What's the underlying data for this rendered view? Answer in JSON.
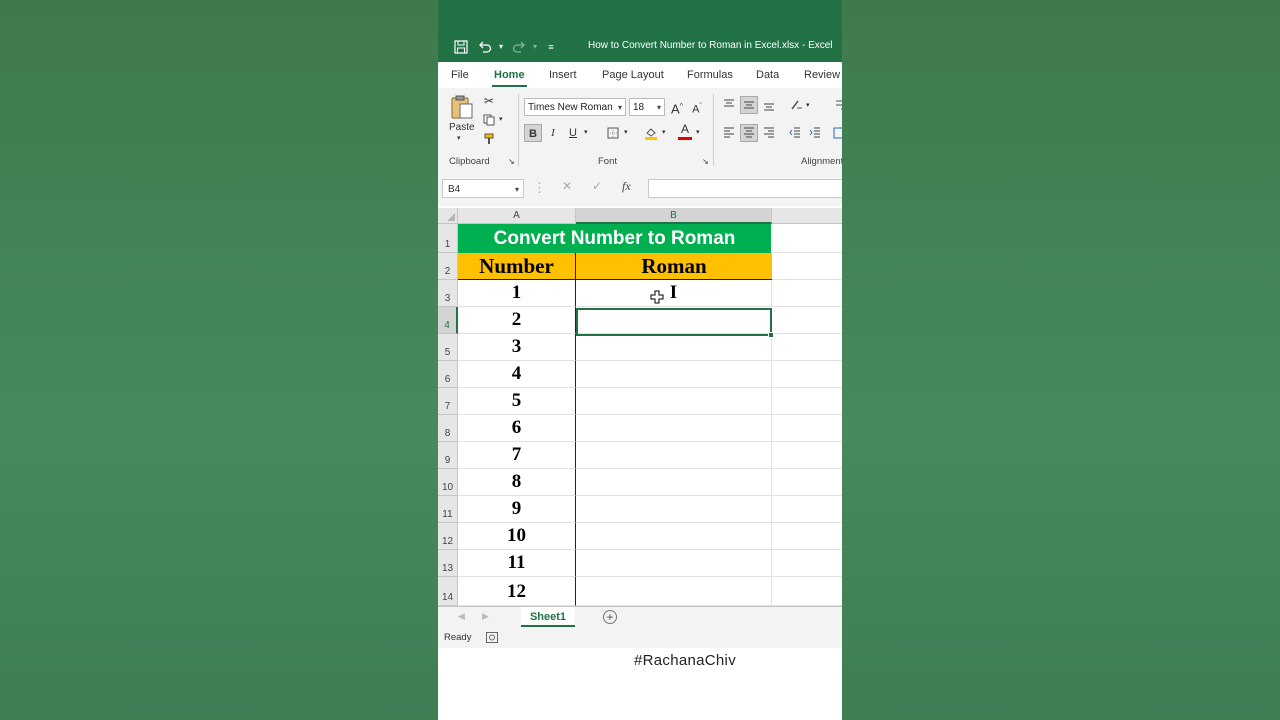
{
  "window": {
    "title": "How to Convert Number to Roman in Excel.xlsx  -  Excel"
  },
  "ribbon": {
    "tabs": [
      "File",
      "Home",
      "Insert",
      "Page Layout",
      "Formulas",
      "Data",
      "Review"
    ],
    "active_tab": "Home",
    "clipboard": {
      "paste_label": "Paste",
      "group_label": "Clipboard"
    },
    "font": {
      "font_name": "Times New Roman",
      "font_size": "18",
      "grow_label": "A",
      "shrink_label": "A",
      "bold_label": "B",
      "italic_label": "I",
      "underline_label": "U",
      "color_label": "A",
      "group_label": "Font"
    },
    "alignment": {
      "group_label": "Alignment"
    }
  },
  "formula_bar": {
    "name_box": "B4",
    "cancel_symbol": "✕",
    "enter_symbol": "✓",
    "fx_label": "fx",
    "content": ""
  },
  "sheet": {
    "columns": [
      "A",
      "B"
    ],
    "selected_column": "B",
    "selected_row": "4",
    "title": "Convert Number to Roman",
    "headers": {
      "number": "Number",
      "roman": "Roman"
    },
    "row_numbers": [
      "1",
      "2",
      "3",
      "4",
      "5",
      "6",
      "7",
      "8",
      "9",
      "10",
      "11",
      "12",
      "13",
      "14"
    ],
    "rows": [
      {
        "number": "1",
        "roman": "I"
      },
      {
        "number": "2",
        "roman": ""
      },
      {
        "number": "3",
        "roman": ""
      },
      {
        "number": "4",
        "roman": ""
      },
      {
        "number": "5",
        "roman": ""
      },
      {
        "number": "6",
        "roman": ""
      },
      {
        "number": "7",
        "roman": ""
      },
      {
        "number": "8",
        "roman": ""
      },
      {
        "number": "9",
        "roman": ""
      },
      {
        "number": "10",
        "roman": ""
      },
      {
        "number": "11",
        "roman": ""
      },
      {
        "number": "12",
        "roman": ""
      }
    ]
  },
  "sheet_tabs": {
    "active": "Sheet1",
    "add_symbol": "+"
  },
  "status": {
    "text": "Ready"
  },
  "overlay": {
    "hashtag": "#RachanaChiv"
  },
  "colors": {
    "excel_green": "#217346",
    "title_fill": "#00b050",
    "header_fill": "#ffc000"
  }
}
